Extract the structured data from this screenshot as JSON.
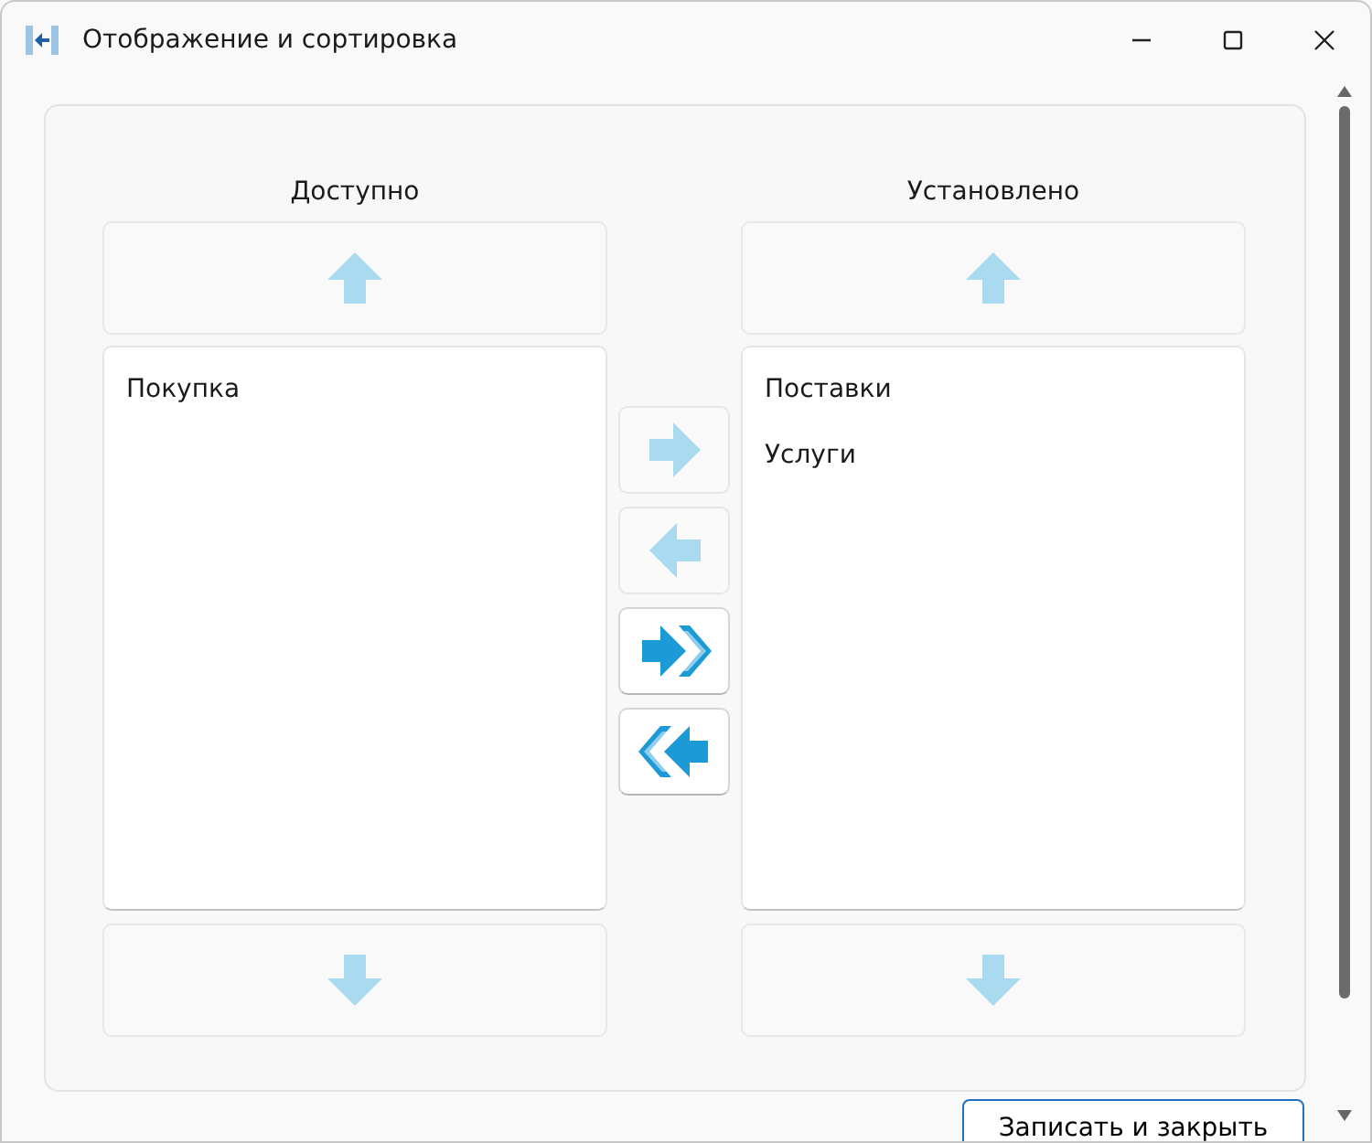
{
  "window": {
    "title": "Отображение и сортировка"
  },
  "lists": [
    {
      "header": "Доступно",
      "items": [
        {
          "label": "Покупка"
        }
      ],
      "move_up": {
        "disabled": true
      },
      "move_down": {
        "disabled": true
      }
    },
    {
      "header": "Установлено",
      "items": [
        {
          "label": "Поставки"
        },
        {
          "label": "Услуги"
        }
      ],
      "move_up": {
        "disabled": true
      },
      "move_down": {
        "disabled": true
      }
    }
  ],
  "transfer_buttons": [
    {
      "kind": "right",
      "disabled": true
    },
    {
      "kind": "left",
      "disabled": true
    },
    {
      "kind": "all-right",
      "disabled": false
    },
    {
      "kind": "all-left",
      "disabled": false
    }
  ],
  "footer_button": {
    "label": "Записать и закрыть"
  }
}
